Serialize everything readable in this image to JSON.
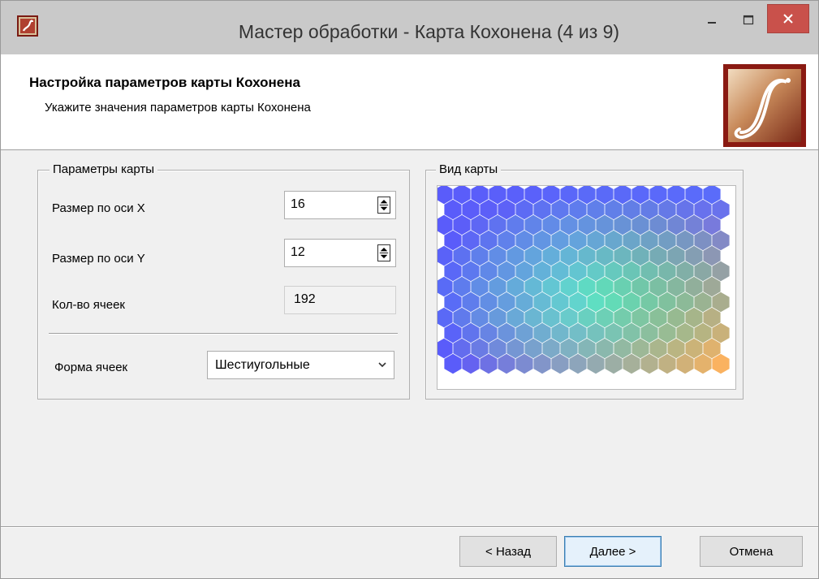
{
  "window": {
    "title": "Мастер обработки - Карта Кохонена (4 из 9)",
    "close_color": "#c9514b"
  },
  "header": {
    "title": "Настройка параметров карты Кохонена",
    "subtitle": "Укажите значения параметров карты Кохонена",
    "logo_icon": "deductor-logo-icon"
  },
  "map_params": {
    "group_label": "Параметры карты",
    "size_x_label": "Размер по оси X",
    "size_x_value": "16",
    "size_y_label": "Размер по оси Y",
    "size_y_value": "12",
    "cells_label": "Кол-во ячеек",
    "cells_value": "192",
    "shape_label": "Форма ячеек",
    "shape_value": "Шестиугольные"
  },
  "map_view": {
    "group_label": "Вид карты",
    "columns": 16,
    "rows": 12,
    "corner_colors": {
      "top_left": "#5a5cfa",
      "top_right": "#5a6cfa",
      "bottom_left": "#5a5cfa",
      "bottom_right": "#ffb060",
      "center": "#55f0d0"
    }
  },
  "buttons": {
    "back": "< Назад",
    "next": "Далее >",
    "cancel": "Отмена"
  }
}
